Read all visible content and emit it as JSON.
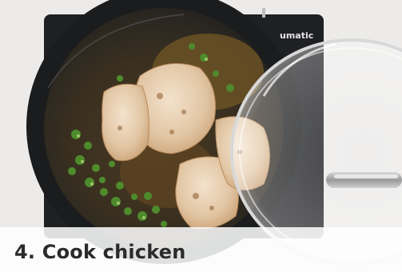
{
  "image": {
    "description_alt": "Chicken cooking in skillet with jalapeños, lid beside",
    "appliance_brand": "umatic"
  },
  "step": {
    "title": "4. Cook chicken"
  },
  "colors": {
    "pan": "#1d1e1f",
    "stovetop": "#1f2023",
    "chicken": "#e8d2b8",
    "jalapeno": "#4e8b2c",
    "caption_text": "#2b2b2b"
  }
}
